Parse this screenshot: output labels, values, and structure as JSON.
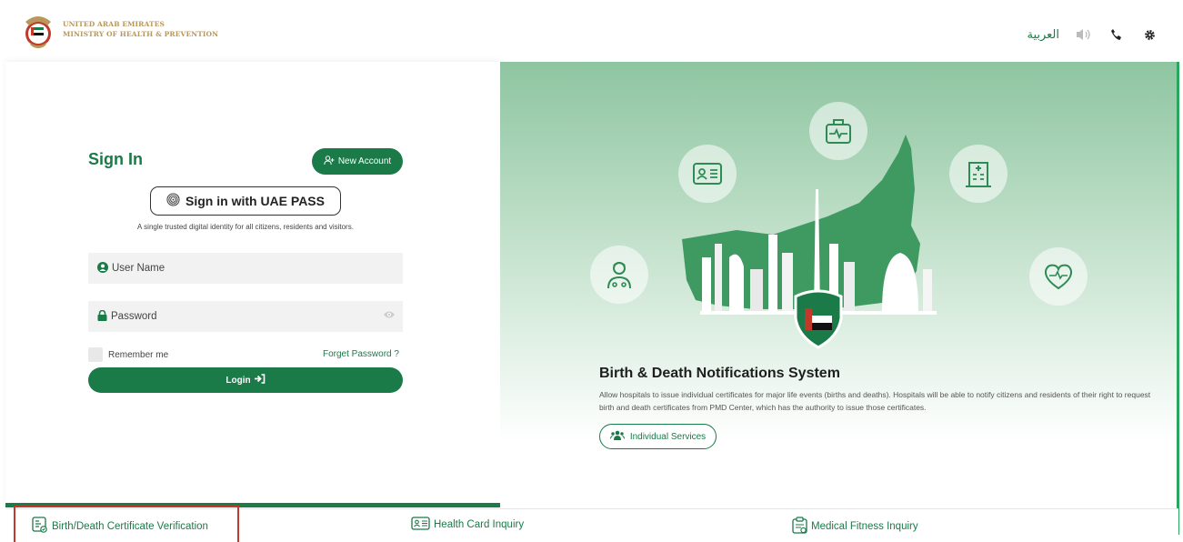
{
  "header": {
    "brand_line1": "UNITED ARAB EMIRATES",
    "brand_line2": "MINISTRY OF HEALTH & PREVENTION",
    "language": "العربية",
    "icons": [
      "speaker-icon",
      "phone-icon",
      "gear-icon"
    ],
    "accent_gold": "#b9975b"
  },
  "signin": {
    "title": "Sign In",
    "new_account": "New Account",
    "uaepass": "Sign in with UAE PASS",
    "trusted": "A single trusted digital identity for all citizens, residents and visitors.",
    "username_placeholder": "User Name",
    "password_placeholder": "Password",
    "remember": "Remember me",
    "forget": "Forget Password ?",
    "login": "Login"
  },
  "hero": {
    "title": "Birth & Death Notifications System",
    "description": "Allow hospitals to issue individual certificates for major life events (births and deaths). Hospitals will be able to notify citizens and residents of their right to request birth and death certificates from PMD Center, which has the authority to issue those certificates.",
    "services_button": "Individual Services",
    "icons": [
      "medical-kit-icon",
      "id-card-icon",
      "hospital-icon",
      "doctor-icon",
      "heart-icon"
    ]
  },
  "bottom_nav": {
    "items": [
      {
        "label": "Birth/Death Certificate Verification",
        "icon": "certificate-icon",
        "active": true
      },
      {
        "label": "Health Card Inquiry",
        "icon": "id-card-icon",
        "active": false
      },
      {
        "label": "Medical Fitness Inquiry",
        "icon": "clipboard-icon",
        "active": false
      }
    ]
  },
  "colors": {
    "primary": "#1a7a48",
    "active_outline": "#c0392b"
  }
}
